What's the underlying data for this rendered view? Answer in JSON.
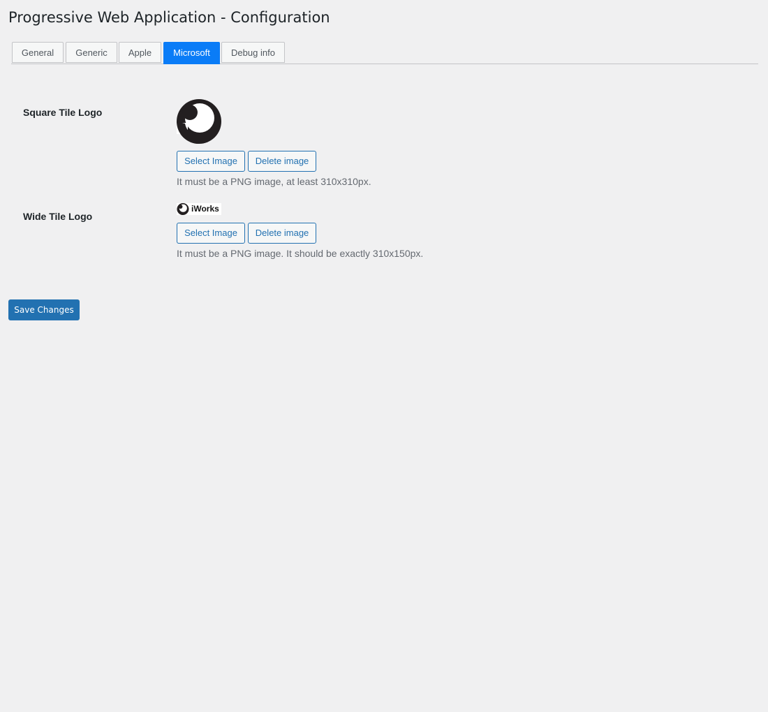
{
  "page": {
    "title": "Progressive Web Application - Configuration"
  },
  "tabs": [
    {
      "label": "General",
      "active": false
    },
    {
      "label": "Generic",
      "active": false
    },
    {
      "label": "Apple",
      "active": false
    },
    {
      "label": "Microsoft",
      "active": true
    },
    {
      "label": "Debug info",
      "active": false
    }
  ],
  "fields": {
    "square_tile": {
      "label": "Square Tile Logo",
      "select_label": "Select Image",
      "delete_label": "Delete image",
      "description": "It must be a PNG image, at least 310x310px."
    },
    "wide_tile": {
      "label": "Wide Tile Logo",
      "logo_text": "iWorks",
      "select_label": "Select Image",
      "delete_label": "Delete image",
      "description": "It must be a PNG image. It should be exactly 310x150px."
    }
  },
  "footer": {
    "save_label": "Save Changes"
  },
  "colors": {
    "accent": "#2271b1",
    "active_tab": "#0a7cf7",
    "background": "#f0f0f1"
  }
}
